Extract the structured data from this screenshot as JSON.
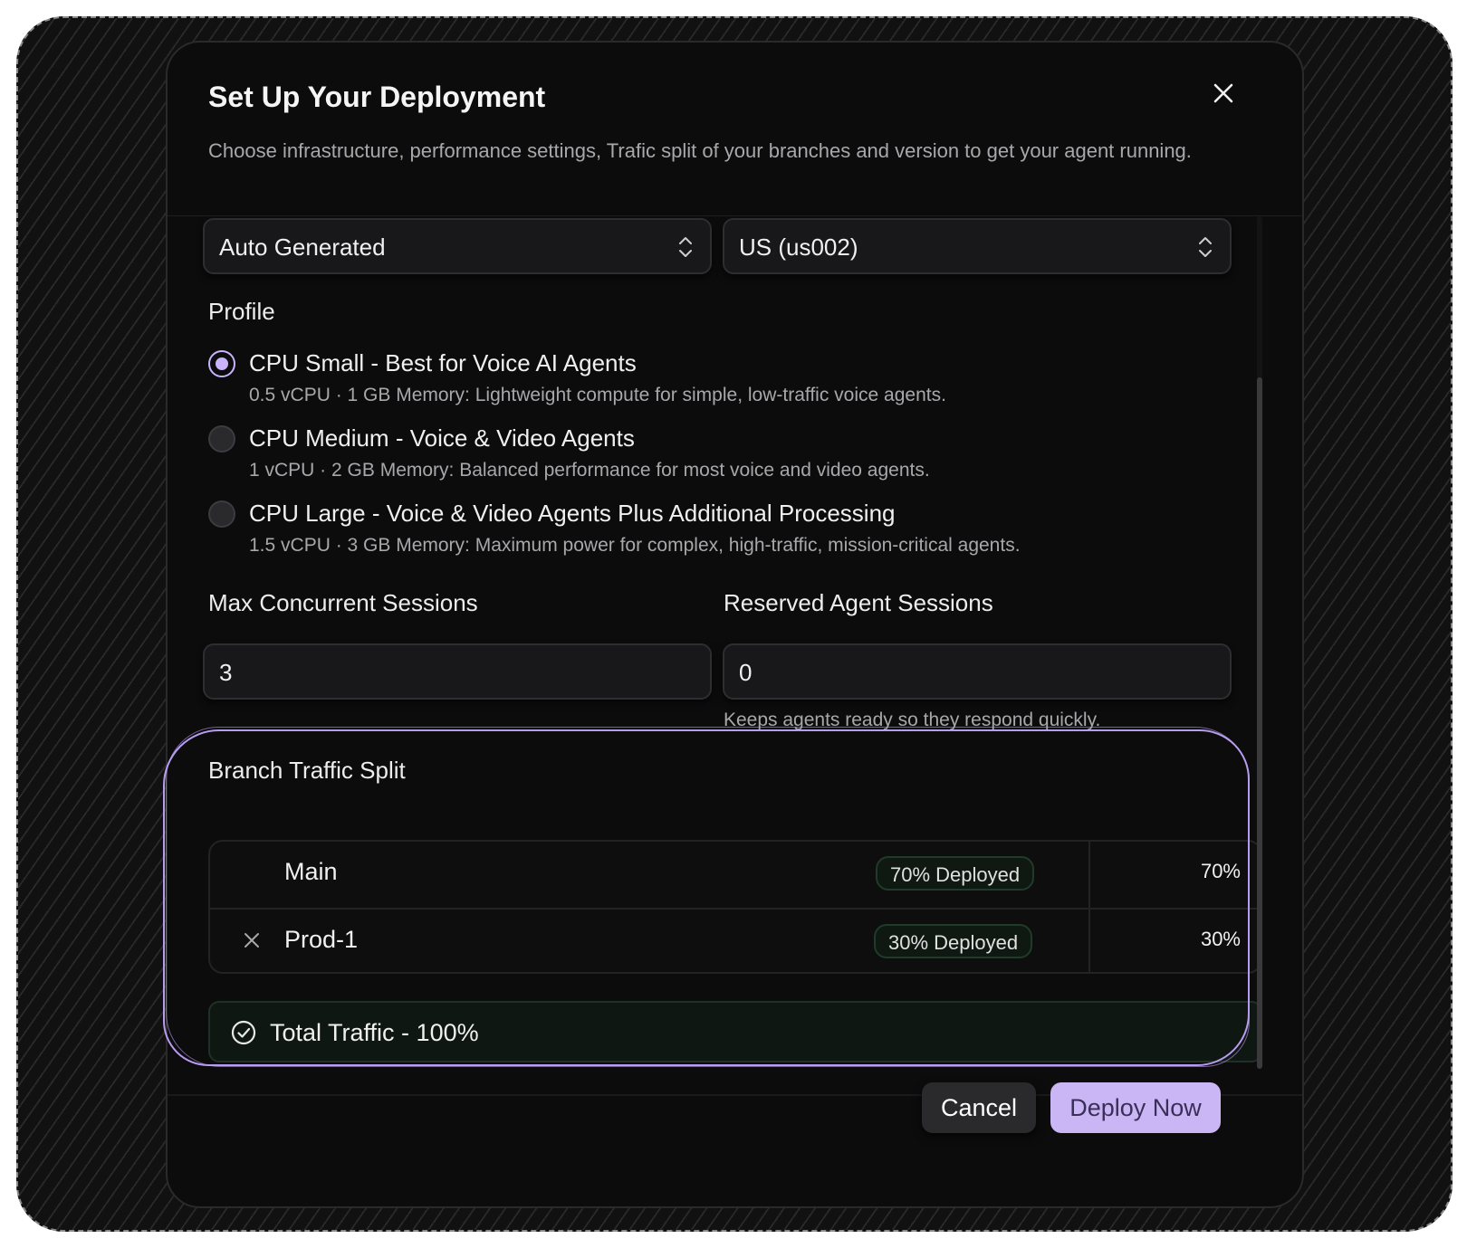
{
  "dialog": {
    "title": "Set Up Your Deployment",
    "description": "Choose infrastructure, performance settings, Trafic split of your branches and version to get your agent running."
  },
  "selects": {
    "name_value": "Auto Generated",
    "region_value": "US (us002)"
  },
  "profile": {
    "label": "Profile",
    "options": [
      {
        "title": "CPU Small - Best for Voice AI Agents",
        "desc": "0.5 vCPU · 1 GB Memory: Lightweight compute for simple, low-traffic voice agents.",
        "selected": true
      },
      {
        "title": "CPU Medium - Voice & Video Agents",
        "desc": "1 vCPU · 2 GB Memory: Balanced performance for most voice and video agents.",
        "selected": false
      },
      {
        "title": "CPU Large - Voice & Video Agents Plus Additional Processing",
        "desc": "1.5 vCPU · 3 GB Memory: Maximum power for complex, high-traffic, mission-critical agents.",
        "selected": false
      }
    ]
  },
  "sessions": {
    "max_label": "Max Concurrent Sessions",
    "max_value": "3",
    "reserved_label": "Reserved Agent Sessions",
    "reserved_value": "0",
    "reserved_hint": "Keeps agents ready so they respond quickly."
  },
  "traffic": {
    "label": "Branch Traffic Split",
    "rows": [
      {
        "name": "Main",
        "badge": "70% Deployed",
        "percent": "70%"
      },
      {
        "name": "Prod-1",
        "badge": "30% Deployed",
        "percent": "30%"
      }
    ],
    "total": "Total Traffic - 100%"
  },
  "footer": {
    "cancel": "Cancel",
    "deploy": "Deploy Now"
  },
  "colors": {
    "accent": "#cbb6f5",
    "radio_selected": "#c9b3ff",
    "success_bg": "#0f1712",
    "highlight_outline": "#b89cf0"
  },
  "icons": {
    "close": "close-icon",
    "select": "chevron-up-down-icon",
    "remove": "x-icon",
    "total": "check-circle-icon"
  }
}
